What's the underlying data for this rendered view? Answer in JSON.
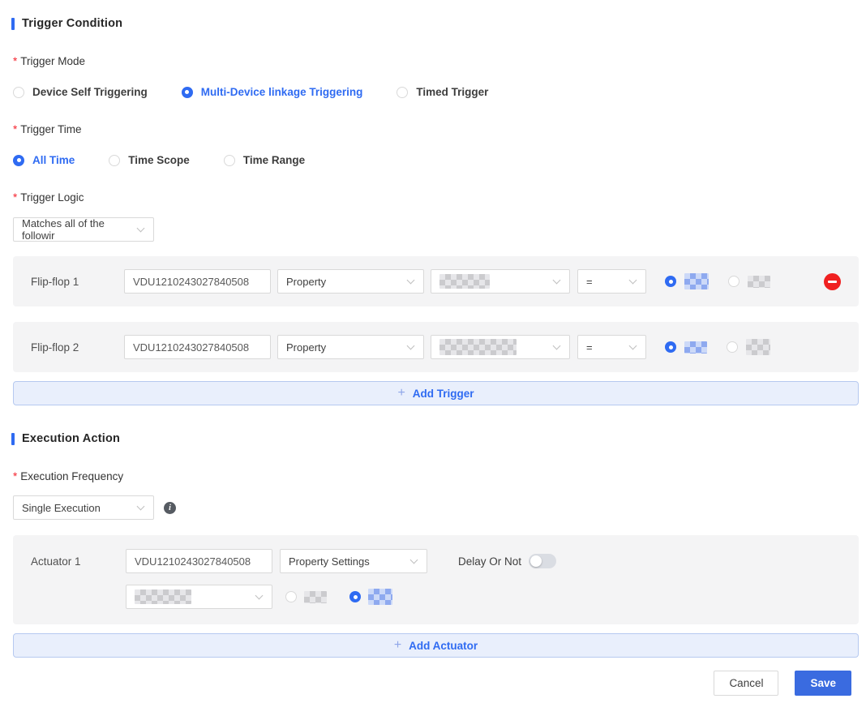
{
  "required_marker": "*",
  "colors": {
    "accent_blue": "#2f6bf2",
    "save_button_blue": "#3a6be0",
    "danger_red": "#f02020",
    "asterisk_red": "#f5222d",
    "row_background_grey": "#f4f4f5",
    "add_bar_background": "#e9effc",
    "add_bar_border": "#b6c9f0"
  },
  "icons": {
    "plus": "+",
    "info": "i"
  },
  "trigger_condition": {
    "title": "Trigger Condition",
    "trigger_mode": {
      "label": "Trigger Mode",
      "options": [
        {
          "label": "Device Self Triggering",
          "selected": false
        },
        {
          "label": "Multi-Device linkage Triggering",
          "selected": true
        },
        {
          "label": "Timed Trigger",
          "selected": false
        }
      ]
    },
    "trigger_time": {
      "label": "Trigger Time",
      "options": [
        {
          "label": "All Time",
          "selected": true
        },
        {
          "label": "Time Scope",
          "selected": false
        },
        {
          "label": "Time Range",
          "selected": false
        }
      ]
    },
    "trigger_logic": {
      "label": "Trigger Logic",
      "selected_value": "Matches all of the followir"
    },
    "flip_flops": [
      {
        "label": "Flip-flop 1",
        "device_id": "VDU1210243027840508",
        "condition_type": "Property",
        "operator": "="
      },
      {
        "label": "Flip-flop 2",
        "device_id": "VDU1210243027840508",
        "condition_type": "Property",
        "operator": "="
      }
    ],
    "add_trigger_label": "Add Trigger"
  },
  "execution_action": {
    "title": "Execution Action",
    "execution_frequency": {
      "label": "Execution Frequency",
      "selected_value": "Single Execution"
    },
    "actuator": {
      "label": "Actuator 1",
      "device_id": "VDU1210243027840508",
      "action_type": "Property Settings",
      "delay_label": "Delay Or Not",
      "delay_enabled": false
    },
    "add_actuator_label": "Add Actuator"
  },
  "footer": {
    "cancel_label": "Cancel",
    "save_label": "Save"
  }
}
